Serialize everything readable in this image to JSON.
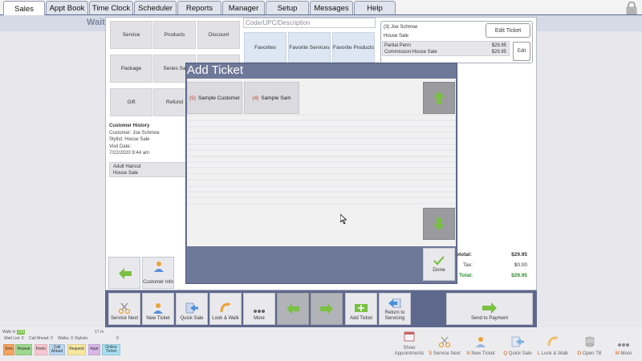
{
  "nav": {
    "tabs": [
      {
        "label": "Sales"
      },
      {
        "label": "Appt Book"
      },
      {
        "label": "Time Clock"
      },
      {
        "label": "Scheduler"
      },
      {
        "label": "Reports"
      },
      {
        "label": "Manager"
      },
      {
        "label": "Setup"
      },
      {
        "label": "Messages"
      },
      {
        "label": "Help"
      }
    ],
    "active_tab": "Sales"
  },
  "background": {
    "wait_label": "Wait"
  },
  "categories": [
    "Service",
    "Products",
    "Discount",
    "Package",
    "Series Sa",
    "Gift",
    "Refund"
  ],
  "search": {
    "placeholder": "Code/UPC/Description"
  },
  "favorites": [
    "Favorites",
    "Favorite Services",
    "Favorite Products"
  ],
  "customer_history": {
    "title": "Customer History",
    "customer": "Customer: Joe Schmoe",
    "stylist": "Stylist: House Sale",
    "visit_label": "Visit Date:",
    "visit_date": "7/22/2020 9:44 am",
    "service_line1": "Adult Haircut",
    "service_line2": "House Sale"
  },
  "ticket": {
    "header": "(3) Joe Schmoe",
    "sub": "House Sale",
    "edit_ticket_label": "Edit Ticket",
    "item_name": "Partial Perm",
    "item_price": "$29.95",
    "commission": "Commission:House Sale",
    "commission_price": "$29.95",
    "edit_label": "Edit"
  },
  "totals": {
    "subtotal_label": "btotal:",
    "subtotal": "$29.95",
    "tax_label": "Tax:",
    "tax": "$0.00",
    "total_label": "Total:",
    "total": "$29.95"
  },
  "customer_info_label": "Customer Info",
  "action_bar": {
    "service_next": "Service Next",
    "new_ticket": "New Ticket",
    "quick_sale": "Quick Sale",
    "look_walk": "Look & Walk",
    "more": "More",
    "add_ticket": "Add Ticket",
    "return_servicing": "Return to Servicing",
    "send_payment": "Send to Payment"
  },
  "dialog": {
    "title": "Add Ticket",
    "staff": [
      {
        "num": "(5)",
        "name": "Sample Customer"
      },
      {
        "num": "(4)",
        "name": "Sample Sam"
      }
    ],
    "done_label": "Done"
  },
  "status": {
    "walk_in_label": "Walk In",
    "walk_in_value": "123",
    "wait_list": "Wait List: 0",
    "call_ahead": "Call Ahead: 0",
    "walks": "Walks: 0",
    "stylists": "Stylists:",
    "minutes": "17 m",
    "count": "0"
  },
  "status_buttons": [
    {
      "label": "Sms",
      "color": "#f4a460"
    },
    {
      "label": "Repeat",
      "color": "#9fd88f"
    },
    {
      "label": "Redo",
      "color": "#f7c6d0"
    },
    {
      "label": "Call Ahead",
      "color": "#b9d5f0"
    },
    {
      "label": "Request",
      "color": "#f5e79e"
    },
    {
      "label": "Appt",
      "color": "#d9b8e8"
    },
    {
      "label": "Online Ticket",
      "color": "#a8dff0"
    }
  ],
  "quick_bar": [
    {
      "key": "",
      "label": "Show Appointments"
    },
    {
      "key": "S",
      "label": "Service Next"
    },
    {
      "key": "N",
      "label": "New Ticket"
    },
    {
      "key": "Q",
      "label": "Quick Sale"
    },
    {
      "key": "L",
      "label": "Look & Walk"
    },
    {
      "key": "O",
      "label": "Open Till"
    },
    {
      "key": "M",
      "label": "More"
    }
  ],
  "colors": {
    "nav_border": "#5a6a8c",
    "dialog": "#6e7898",
    "action_bar": "#5e688c",
    "total_green": "#2e8b2e",
    "arrow_green": "#7bc043"
  }
}
